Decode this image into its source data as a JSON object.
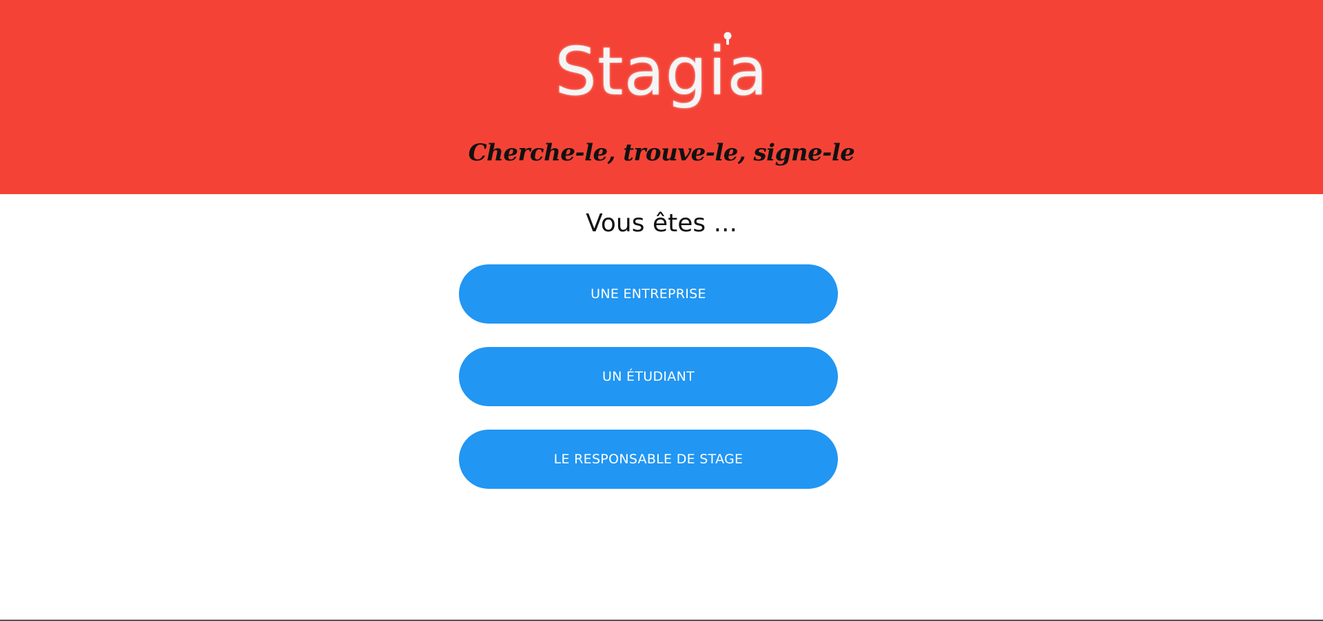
{
  "header": {
    "logo_text": "Stagia",
    "tagline": "Cherche-le, trouve-le, signe-le",
    "background_color": "#f44336",
    "logo_icon": "lightbulb-icon"
  },
  "main": {
    "question": "Vous êtes ...",
    "choices": [
      {
        "label": "UNE ENTREPRISE"
      },
      {
        "label": "UN ÉTUDIANT"
      },
      {
        "label": "LE RESPONSABLE DE STAGE"
      }
    ],
    "button_color": "#2196f3"
  }
}
